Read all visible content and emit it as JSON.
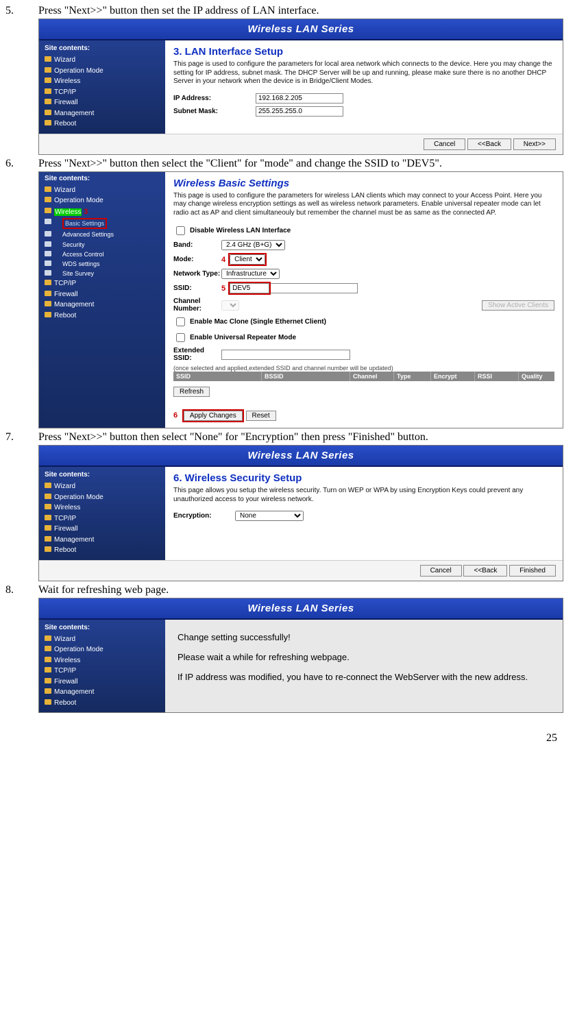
{
  "steps": {
    "5": {
      "num": "5.",
      "text": "Press \"Next>>\" button then set the IP address of LAN interface."
    },
    "6": {
      "num": "6.",
      "text": "Press \"Next>>\" button then select the \"Client\" for \"mode\" and change the SSID to \"DEV5\"."
    },
    "7": {
      "num": "7.",
      "text": "Press \"Next>>\" button then select \"None\" for \"Encryption\" then press \"Finished\" button."
    },
    "8": {
      "num": "8.",
      "text": "Wait for refreshing web page."
    }
  },
  "shot1": {
    "banner": "Wireless LAN Series",
    "site_contents": "Site contents:",
    "nav": [
      "Wizard",
      "Operation Mode",
      "Wireless",
      "TCP/IP",
      "Firewall",
      "Management",
      "Reboot"
    ],
    "title": "3. LAN Interface Setup",
    "desc": "This page is used to configure the parameters for local area network which connects to the device. Here you may change the setting for IP address, subnet mask. The DHCP Server will be up and running, please make sure there is no another DHCP Server in your network when the device is in Bridge/Client Modes.",
    "ip_lbl": "IP Address:",
    "ip_val": "192.168.2.205",
    "mask_lbl": "Subnet Mask:",
    "mask_val": "255.255.255.0",
    "btns": {
      "cancel": "Cancel",
      "back": "<<Back",
      "next": "Next>>"
    }
  },
  "shot2": {
    "banner": "Wireless Basic Settings",
    "site_contents": "Site contents:",
    "nav_top": [
      "Wizard",
      "Operation Mode"
    ],
    "nav_wireless": "Wireless",
    "nav_sub": [
      "Basic Settings",
      "Advanced Settings",
      "Security",
      "Access Control",
      "WDS settings",
      "Site Survey"
    ],
    "nav_bottom": [
      "TCP/IP",
      "Firewall",
      "Management",
      "Reboot"
    ],
    "desc": "This page is used to configure the parameters for wireless LAN clients which may connect to your Access Point. Here you may change wireless encryption settings as well as wireless network parameters. Enable universal repeater mode can let radio act as AP and client simultaneouly but remember the channel must be as same as the connected AP.",
    "disable_chk": "Disable Wireless LAN Interface",
    "band_lbl": "Band:",
    "band_val": "2.4 GHz (B+G)",
    "mode_lbl": "Mode:",
    "mode_val": "Client",
    "nettype_lbl": "Network Type:",
    "nettype_val": "Infrastructure",
    "ssid_lbl": "SSID:",
    "ssid_val": "DEV5",
    "chan_lbl": "Channel Number:",
    "show_clients": "Show Active Clients",
    "mac_clone": "Enable Mac Clone (Single Ethernet Client)",
    "univ_rep": "Enable Universal Repeater Mode",
    "ext_ssid_lbl": "Extended SSID:",
    "note": "(once selected and applied,extended SSID and channel number will be updated)",
    "table_hdr": [
      "SSID",
      "BSSID",
      "Channel",
      "Type",
      "Encrypt",
      "RSSI",
      "Quality"
    ],
    "refresh": "Refresh",
    "apply": "Apply Changes",
    "reset": "Reset",
    "annos": {
      "a3": "3",
      "a4": "4",
      "a5": "5",
      "a6": "6"
    }
  },
  "shot3": {
    "banner": "Wireless LAN Series",
    "site_contents": "Site contents:",
    "nav": [
      "Wizard",
      "Operation Mode",
      "Wireless",
      "TCP/IP",
      "Firewall",
      "Management",
      "Reboot"
    ],
    "title": "6. Wireless Security Setup",
    "desc": "This page allows you setup the wireless security. Turn on WEP or WPA by using Encryption Keys could prevent any unauthorized access to your wireless network.",
    "enc_lbl": "Encryption:",
    "enc_val": "None",
    "btns": {
      "cancel": "Cancel",
      "back": "<<Back",
      "finished": "Finished"
    }
  },
  "shot4": {
    "banner": "Wireless LAN Series",
    "site_contents": "Site contents:",
    "nav": [
      "Wizard",
      "Operation Mode",
      "Wireless",
      "TCP/IP",
      "Firewall",
      "Management",
      "Reboot"
    ],
    "line1": "Change setting successfully!",
    "line2": "Please wait a while for refreshing webpage.",
    "line3": "If IP address was modified, you have to re-connect the WebServer with the new address."
  },
  "page_number": "25"
}
